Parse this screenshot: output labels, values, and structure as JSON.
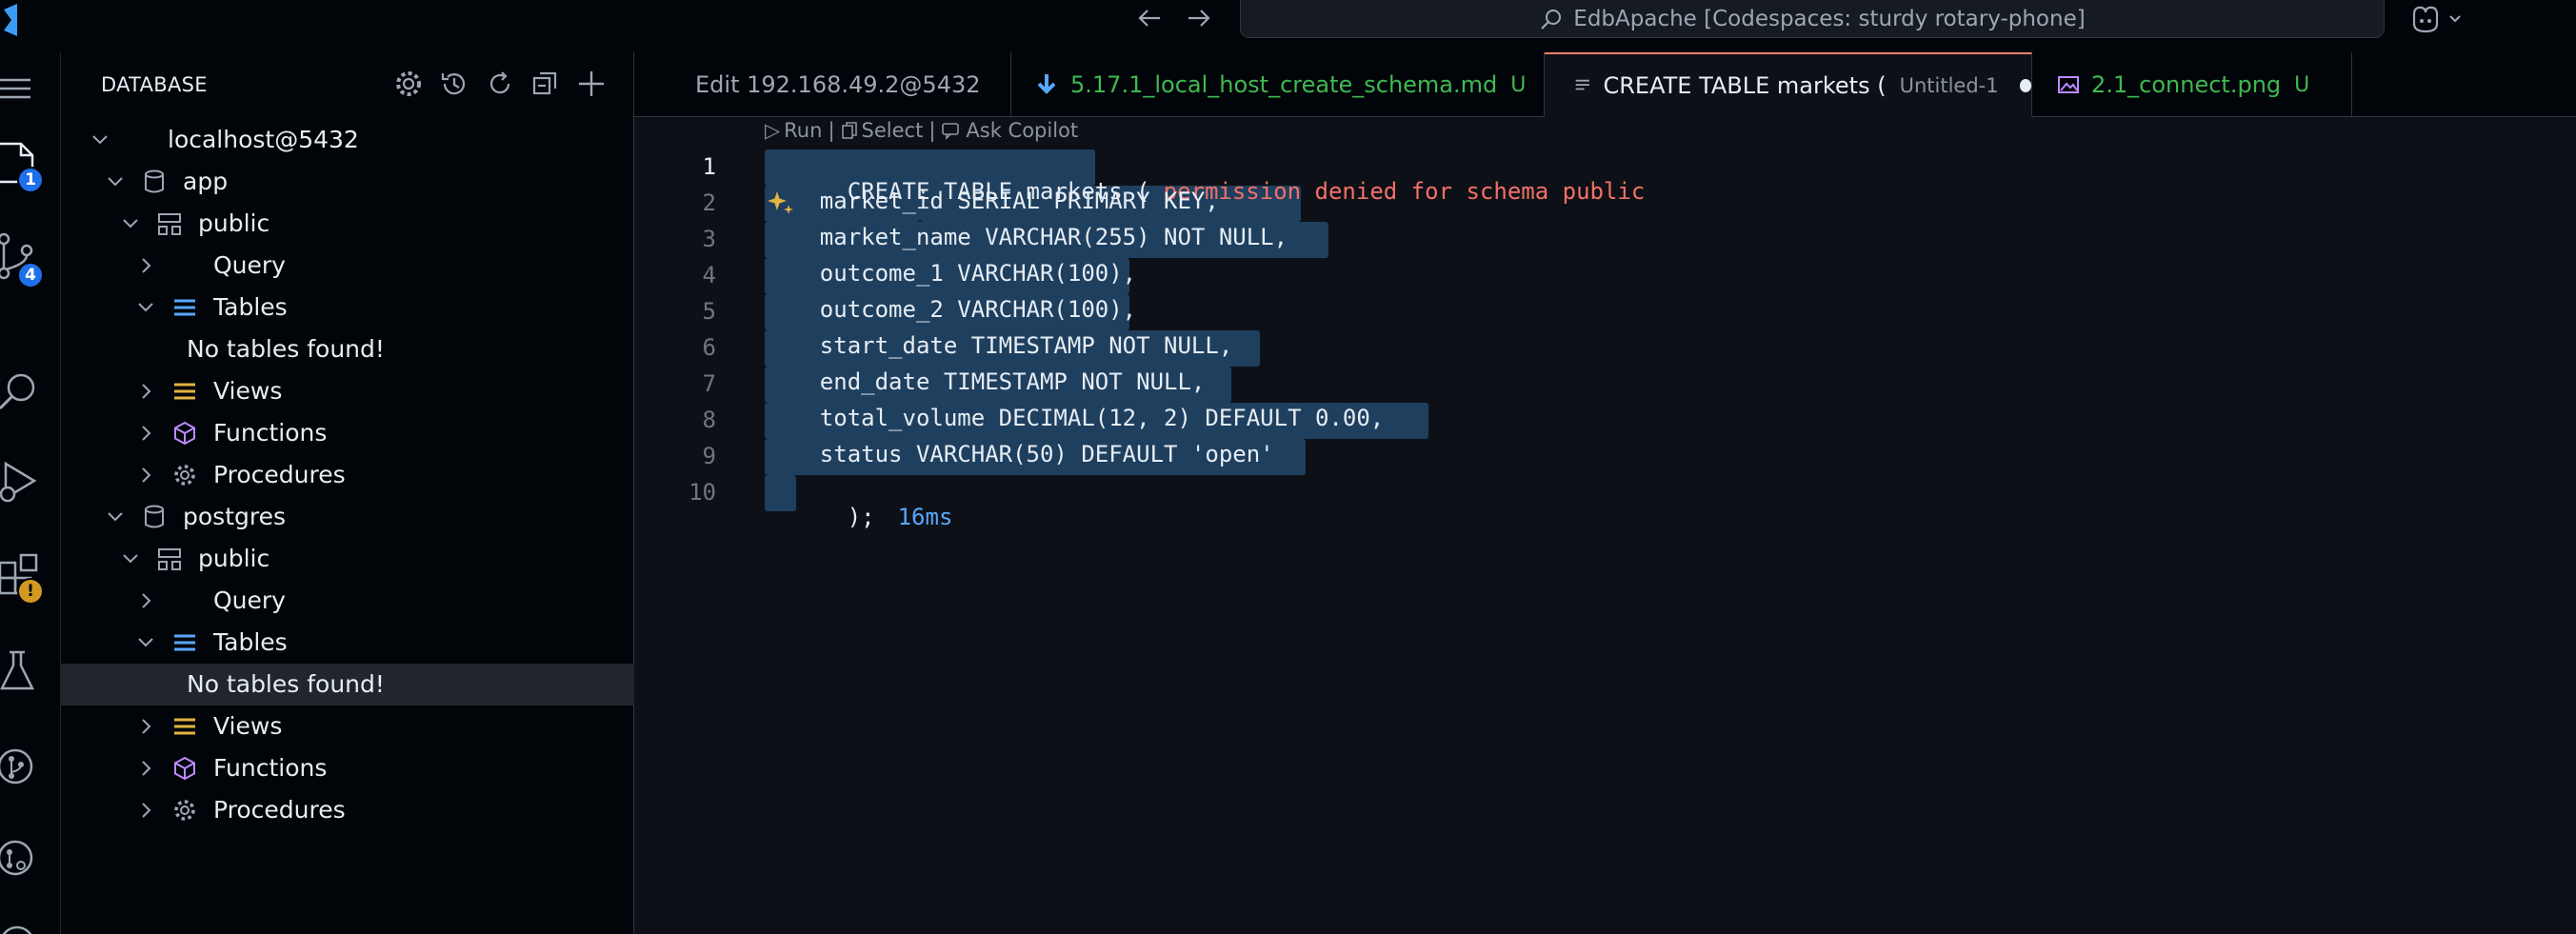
{
  "titlebar": {
    "command_center": "EdbApache [Codespaces: sturdy rotary-phone]"
  },
  "activity_bar": {
    "explorer_badge": "1",
    "source_control_badge": "4",
    "extensions_badge": "!"
  },
  "sidebar": {
    "title": "DATABASE",
    "tree": {
      "connection": "localhost@5432",
      "db_app": "app",
      "app_schema": "public",
      "app_query": "Query",
      "app_tables": "Tables",
      "app_no_tables": "No tables found!",
      "app_views": "Views",
      "app_functions": "Functions",
      "app_procedures": "Procedures",
      "db_postgres": "postgres",
      "pg_schema": "public",
      "pg_query": "Query",
      "pg_tables": "Tables",
      "pg_no_tables": "No tables found!",
      "pg_views": "Views",
      "pg_functions": "Functions",
      "pg_procedures": "Procedures"
    }
  },
  "tabs": [
    {
      "label": "Edit 192.168.49.2@5432"
    },
    {
      "label": "5.17.1_local_host_create_schema.md",
      "status": "U"
    },
    {
      "label": "CREATE TABLE markets (",
      "description": "Untitled-1"
    },
    {
      "label": "2.1_connect.png",
      "status": "U"
    }
  ],
  "editor": {
    "codelens": {
      "run": "Run",
      "select": "Select",
      "ask": "Ask Copilot"
    },
    "line_numbers": [
      "1",
      "2",
      "3",
      "4",
      "5",
      "6",
      "7",
      "8",
      "9",
      "10"
    ],
    "lines": [
      "CREATE TABLE markets (",
      "    market_id SERIAL PRIMARY KEY,",
      "    market_name VARCHAR(255) NOT NULL,",
      "    outcome_1 VARCHAR(100),",
      "    outcome_2 VARCHAR(100),",
      "    start_date TIMESTAMP NOT NULL,",
      "    end_date TIMESTAMP NOT NULL,",
      "    total_volume DECIMAL(12, 2) DEFAULT 0.00,",
      "    status VARCHAR(50) DEFAULT 'open'",
      ");"
    ],
    "error_message": "permission denied for schema public",
    "execution_time": "16ms"
  },
  "colors": {
    "background": "#0d1117",
    "selection": "#264f78",
    "error": "#f47067",
    "untracked": "#3fb950",
    "accent": "#1f6feb",
    "warning": "#d29922"
  }
}
